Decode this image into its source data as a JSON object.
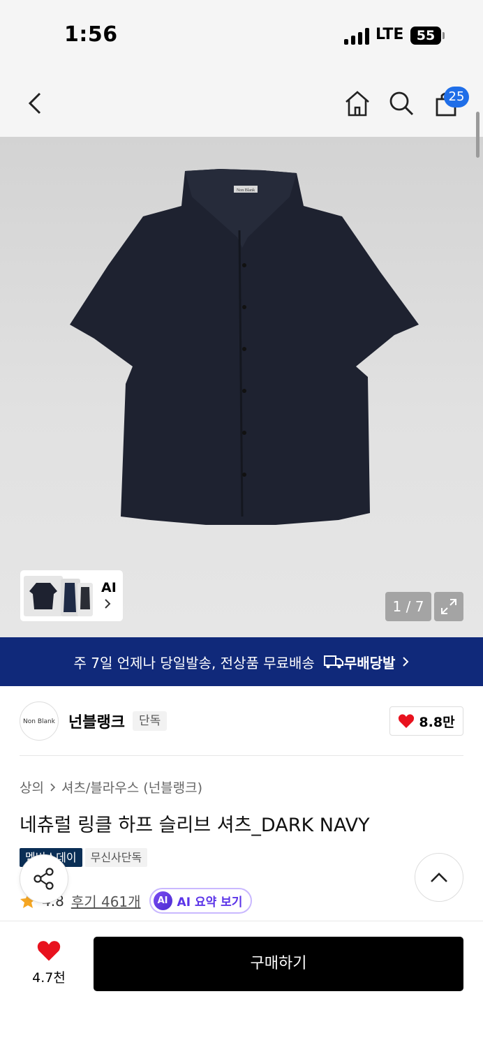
{
  "status_bar": {
    "time": "1:56",
    "network": "LTE",
    "battery": "55"
  },
  "header": {
    "cart_count": "25"
  },
  "gallery": {
    "counter": "1 / 7",
    "ai_label": "AI",
    "shirt_label": "Non Blank"
  },
  "banner": {
    "text": "주 7일 언제나 당일발송, 전상품 무료배송",
    "logo_text": "무배당발"
  },
  "brand": {
    "logo_text": "Non Blank",
    "name": "넌블랭크",
    "tag": "단독",
    "likes": "8.8만"
  },
  "breadcrumb": {
    "category": "상의",
    "subcategory": "셔츠/블라우스 (넌블랭크)"
  },
  "product": {
    "title": "네츄럴 링클 하프 슬리브 셔츠_DARK NAVY",
    "tag_primary": "멤버스데이",
    "tag_secondary": "무신사단독",
    "rating": "4.8",
    "reviews": "후기 461개",
    "ai_summary_icon": "AI",
    "ai_summary_label": "AI 요약 보기"
  },
  "bottom": {
    "like_count": "4.7천",
    "buy_label": "구매하기"
  },
  "colors": {
    "accent_blue": "#1f6ee8",
    "banner_navy": "#10297a",
    "tag_navy": "#0a2e55",
    "heart_red": "#e8121e",
    "ai_purple": "#5b34e8"
  },
  "icons": [
    "back-icon",
    "home-icon",
    "search-icon",
    "cart-icon",
    "expand-icon",
    "heart-icon",
    "star-icon",
    "share-icon",
    "chevron-up-icon",
    "chevron-right-icon"
  ]
}
